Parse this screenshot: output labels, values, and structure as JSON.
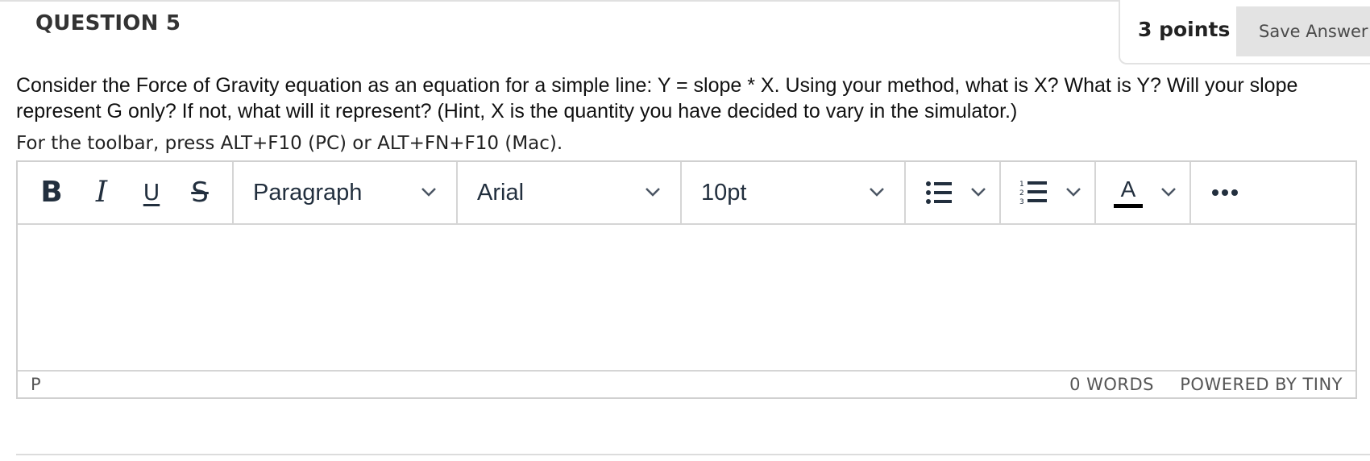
{
  "question": {
    "title": "QUESTION 5",
    "points": "3 points",
    "save_label": "Save Answer",
    "text": "Consider the Force of Gravity equation as an equation for a simple line: Y = slope * X. Using your method, what is X? What is Y? Will your slope represent G only? If not, what will it represent? (Hint, X is the quantity you have decided to vary in the simulator.)"
  },
  "editor": {
    "hint": "For the toolbar, press ALT+F10 (PC) or ALT+FN+F10 (Mac).",
    "toolbar": {
      "bold": "B",
      "italic": "I",
      "underline": "U",
      "strikethrough": "S",
      "block_format": "Paragraph",
      "font_family": "Arial",
      "font_size": "10pt",
      "text_color": "A"
    },
    "status": {
      "path": "P",
      "words": "0 WORDS",
      "branding": "POWERED BY TINY"
    }
  },
  "icons": [
    "bold-icon",
    "italic-icon",
    "underline-icon",
    "strikethrough-icon",
    "chevron-down-icon",
    "bullet-list-icon",
    "numbered-list-icon",
    "text-color-icon",
    "more-icon"
  ],
  "colors": {
    "save_button_bg": "#e3e3e3",
    "toolbar_icon": "#222f3e",
    "border": "#d0d0d0",
    "status_text": "#555555"
  }
}
